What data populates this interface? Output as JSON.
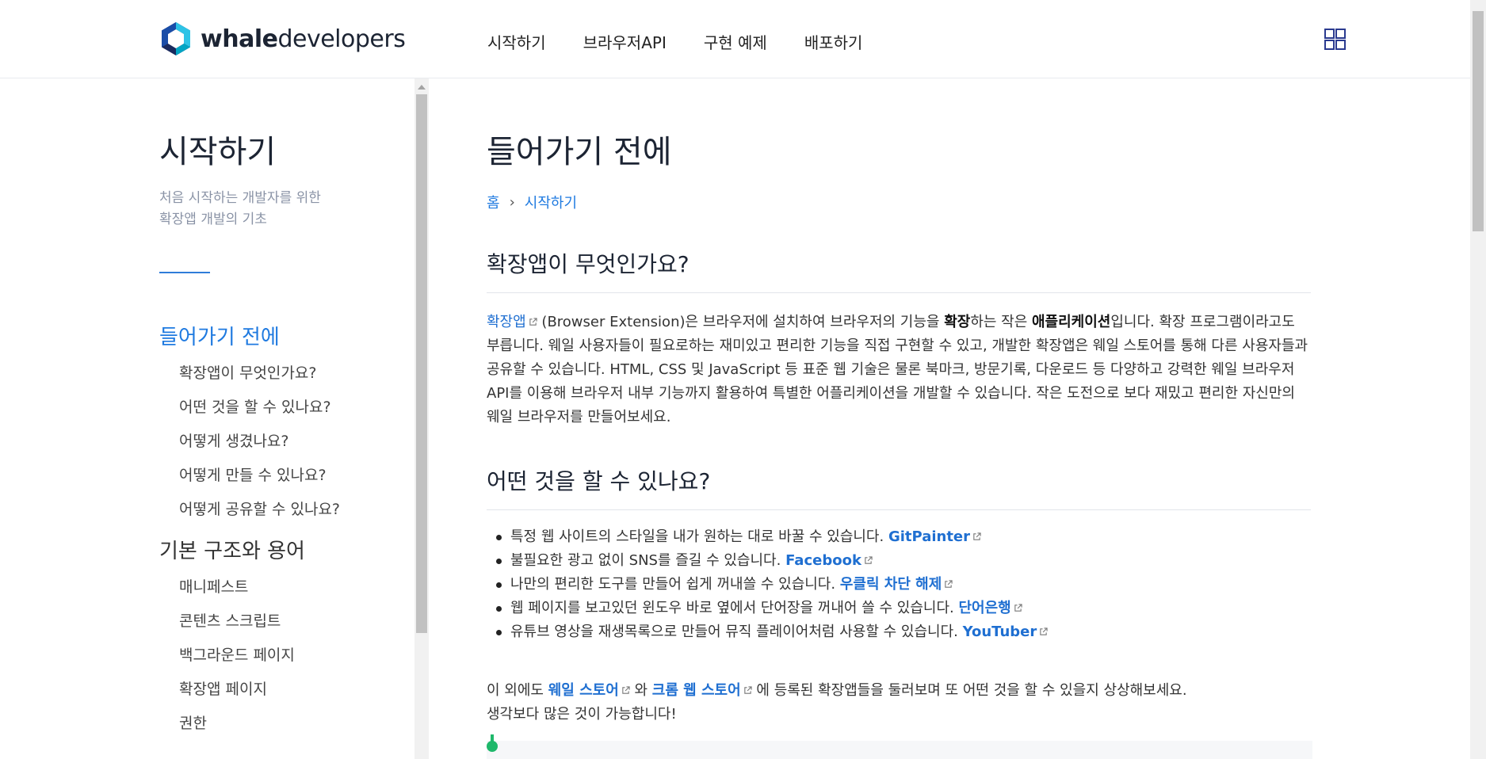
{
  "header": {
    "logo_bold": "whale",
    "logo_regular": "developers",
    "nav": [
      "시작하기",
      "브라우저API",
      "구현 예제",
      "배포하기"
    ]
  },
  "sidebar": {
    "title": "시작하기",
    "desc_line1": "처음 시작하는 개발자를 위한",
    "desc_line2": "확장앱 개발의 기초",
    "sections": [
      {
        "label": "들어가기 전에",
        "active": true,
        "items": [
          "확장앱이 무엇인가요?",
          "어떤 것을 할 수 있나요?",
          "어떻게 생겼나요?",
          "어떻게 만들 수 있나요?",
          "어떻게 공유할 수 있나요?"
        ]
      },
      {
        "label": "기본 구조와 용어",
        "active": false,
        "items": [
          "매니페스트",
          "콘텐츠 스크립트",
          "백그라운드 페이지",
          "확장앱 페이지",
          "권한"
        ]
      }
    ]
  },
  "main": {
    "title": "들어가기 전에",
    "breadcrumb": {
      "home": "홈",
      "current": "시작하기"
    },
    "sec1": {
      "heading": "확장앱이 무엇인가요?",
      "link": "확장앱",
      "t1": "(Browser Extension)은 브라우저에 설치하여 브라우저의 기능을 ",
      "b1": "확장",
      "t2": "하는 작은 ",
      "b2": "애플리케이션",
      "t3": "입니다. 확장 프로그램이라고도 부릅니다. 웨일 사용자들이 필요로하는 재미있고 편리한 기능을 직접 구현할 수 있고, 개발한 확장앱은 웨일 스토어를 통해 다른 사용자들과 공유할 수 있습니다. HTML, CSS 및 JavaScript 등 표준 웹 기술은 물론 북마크, 방문기록, 다운로드 등 다양하고 강력한 웨일 브라우저 API를 이용해 브라우저 내부 기능까지 활용하여 특별한 어플리케이션을 개발할 수 있습니다. 작은 도전으로 보다 재밌고 편리한 자신만의 웨일 브라우저를 만들어보세요."
    },
    "sec2": {
      "heading": "어떤 것을 할 수 있나요?",
      "items": [
        {
          "text": "특정 웹 사이트의 스타일을 내가 원하는 대로 바꿀 수 있습니다. ",
          "link": "GitPainter"
        },
        {
          "text": "불필요한 광고 없이 SNS를 즐길 수 있습니다. ",
          "link": "Facebook"
        },
        {
          "text": "나만의 편리한 도구를 만들어 쉽게 꺼내쓸 수 있습니다. ",
          "link": "우클릭 차단 해제"
        },
        {
          "text": "웹 페이지를 보고있던 윈도우 바로 옆에서 단어장을 꺼내어 쓸 수 있습니다. ",
          "link": "단어은행"
        },
        {
          "text": "유튜브 영상을 재생목록으로 만들어 뮤직 플레이어처럼 사용할 수 있습니다. ",
          "link": "YouTuber"
        }
      ],
      "outro_t1": "이 외에도 ",
      "outro_link1": "웨일 스토어",
      "outro_t2": " 와 ",
      "outro_link2": "크롬 웹 스토어",
      "outro_t3": " 에 등록된 확장앱들을 둘러보며 또 어떤 것을 할 수 있을지 상상해보세요.",
      "outro_line2": "생각보다 많은 것이 가능합니다!"
    }
  },
  "colors": {
    "accent": "#1f7ae0",
    "link": "#1f6fd1",
    "heading": "#1c2433",
    "muted": "#8a93a6",
    "logo_dark": "#1a2a5e",
    "logo_light": "#00c6c2"
  },
  "icons": [
    "whale-logo-icon",
    "apps-grid-icon",
    "external-link-icon",
    "breadcrumb-chevron-icon",
    "tip-icon"
  ]
}
